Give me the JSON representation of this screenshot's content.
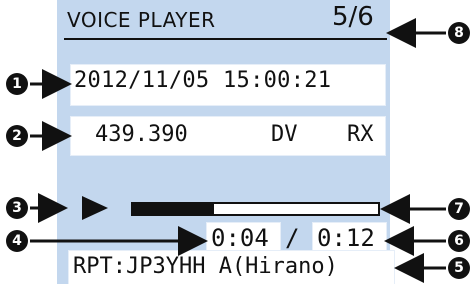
{
  "screen": {
    "title": "VOICE PLAYER",
    "page_indicator": "5/6",
    "datetime": "2012/11/05 15:00:21",
    "frequency": "439.390",
    "mode": "DV",
    "direction": "RX",
    "play_icon": "play-icon",
    "elapsed": "0:04",
    "separator": "/",
    "total": "0:12",
    "progress_fraction": 0.33,
    "repeater": "RPT:JP3YHH A(Hirano)"
  },
  "callouts": {
    "c1": "1",
    "c2": "2",
    "c3": "3",
    "c4": "4",
    "c5": "5",
    "c6": "6",
    "c7": "7",
    "c8": "8"
  }
}
